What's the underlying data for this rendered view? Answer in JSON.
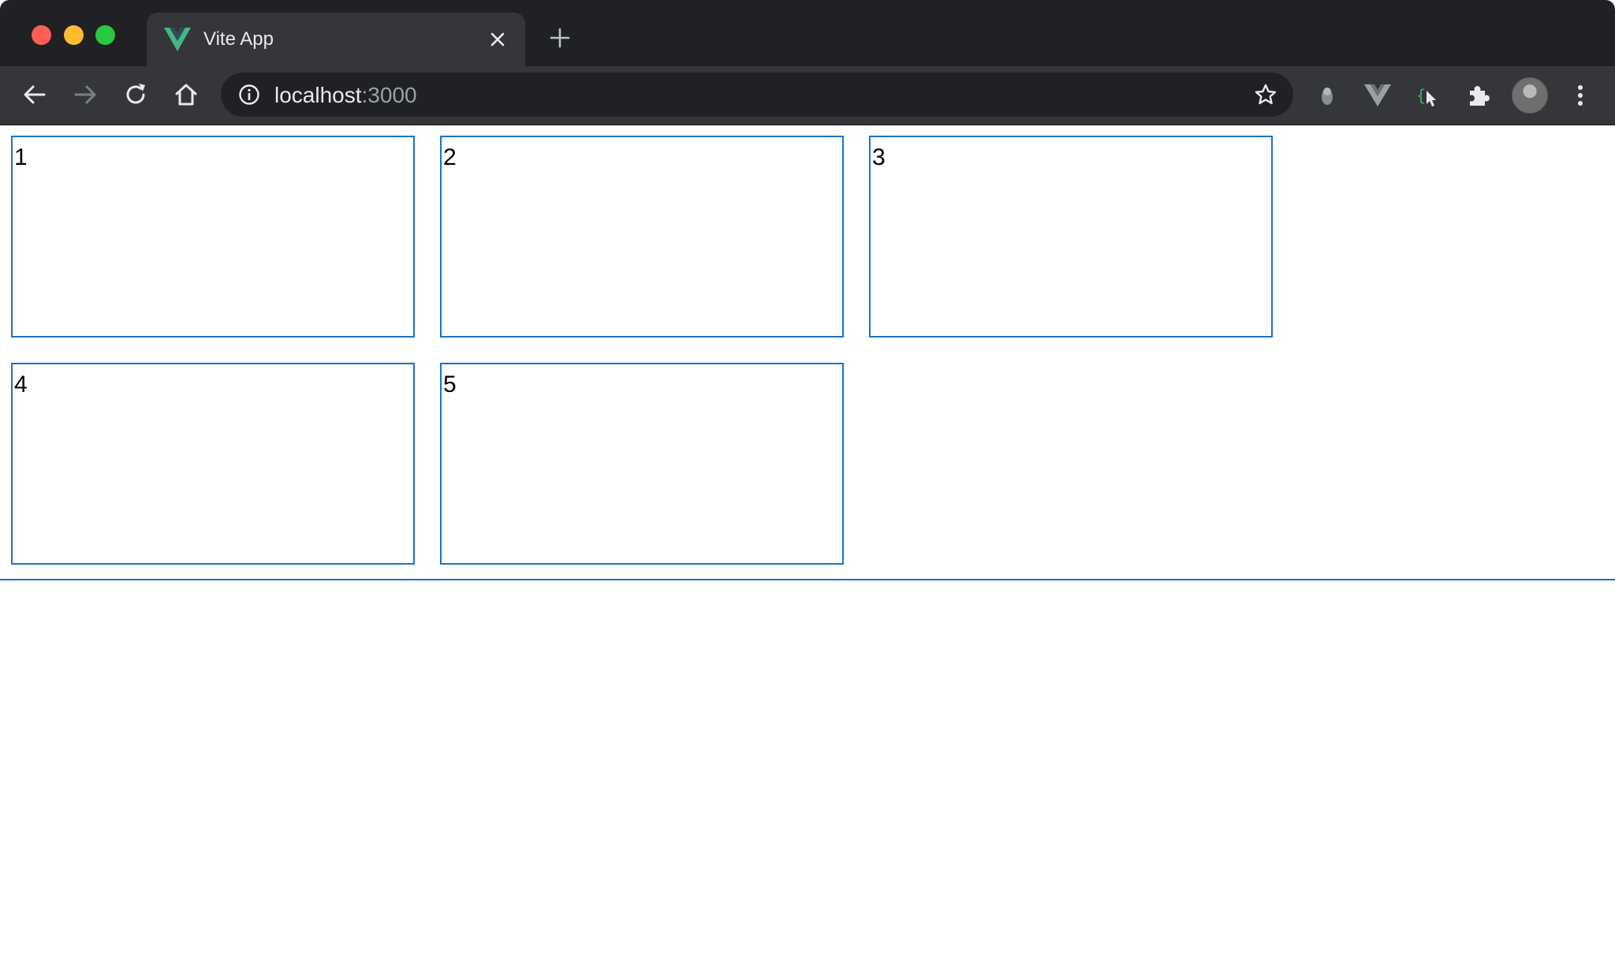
{
  "browser": {
    "tab": {
      "title": "Vite App",
      "favicon": "vue-logo-icon"
    },
    "address_bar": {
      "host": "localhost",
      "port": ":3000"
    },
    "extensions": [
      "mic-extension-icon",
      "vue-devtools-icon",
      "selector-extension-icon",
      "puzzle-extensions-icon"
    ],
    "colors": {
      "tabstrip_bg": "#202124",
      "toolbar_bg": "#35363a",
      "vue_green": "#42b883",
      "item_border": "#1a73c8"
    }
  },
  "page": {
    "items": [
      {
        "label": "1"
      },
      {
        "label": "2"
      },
      {
        "label": "3"
      },
      {
        "label": "4"
      },
      {
        "label": "5"
      }
    ]
  }
}
